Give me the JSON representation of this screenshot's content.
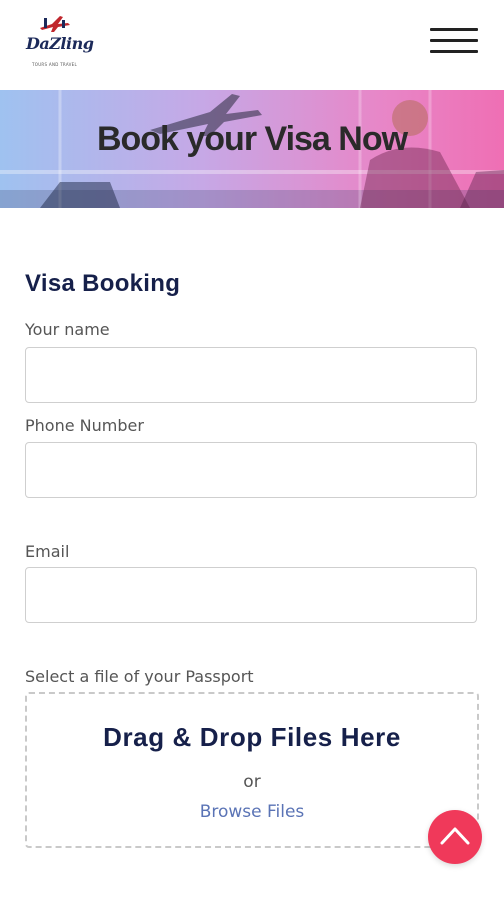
{
  "header": {
    "logo_text": "DaZling",
    "logo_tagline": "TOURS AND TRAVEL",
    "menu_icon": "hamburger-menu-icon"
  },
  "banner": {
    "title": "Book your Visa Now"
  },
  "form": {
    "section_title": "Visa Booking",
    "name_label": "Your name",
    "name_value": "",
    "phone_label": "Phone Number",
    "phone_value": "",
    "email_label": "Email",
    "email_value": "",
    "passport_label": "Select a file of your Passport",
    "dropzone": {
      "title": "Drag & Drop Files Here",
      "or_text": "or",
      "browse_label": "Browse Files"
    }
  },
  "back_to_top": {
    "icon": "chevron-up-icon",
    "color": "#f0395a"
  },
  "colors": {
    "heading": "#16204a",
    "link": "#5a73b5",
    "accent": "#f0395a"
  }
}
